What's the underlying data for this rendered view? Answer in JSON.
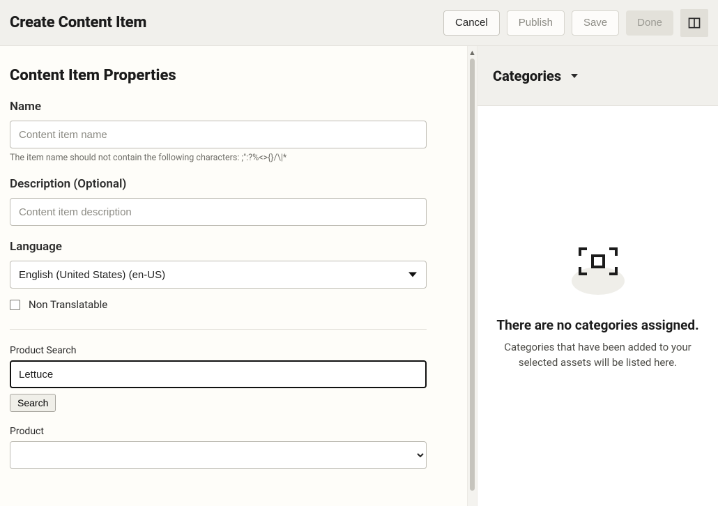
{
  "topbar": {
    "title": "Create Content Item",
    "buttons": {
      "cancel": "Cancel",
      "publish": "Publish",
      "save": "Save",
      "done": "Done"
    }
  },
  "form": {
    "section_title": "Content Item Properties",
    "name": {
      "label": "Name",
      "placeholder": "Content item name",
      "hint": "The item name should not contain the following characters: ;\":?%<>{}/\\|*"
    },
    "description": {
      "label": "Description (Optional)",
      "placeholder": "Content item description"
    },
    "language": {
      "label": "Language",
      "value": "English (United States) (en-US)"
    },
    "non_translatable_label": "Non Translatable",
    "product_search": {
      "label": "Product Search",
      "value": "Lettuce",
      "button": "Search"
    },
    "product": {
      "label": "Product"
    }
  },
  "side": {
    "title": "Categories",
    "empty_title": "There are no categories assigned.",
    "empty_sub": "Categories that have been added to your selected assets will be listed here."
  }
}
